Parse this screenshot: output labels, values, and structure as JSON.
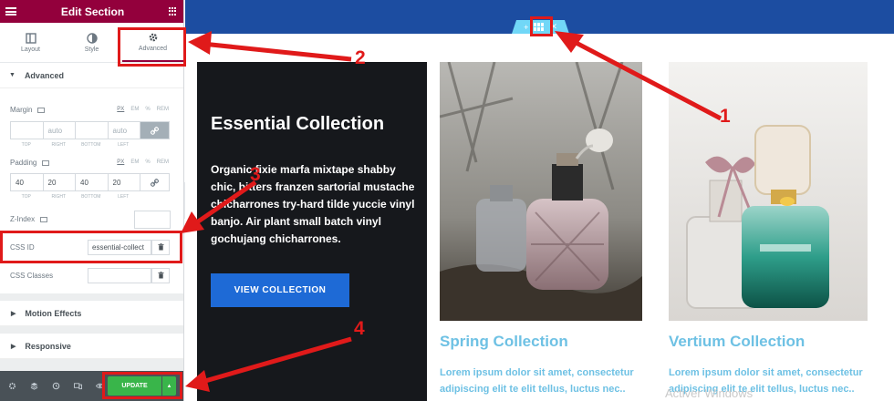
{
  "panel": {
    "title": "Edit Section",
    "tabs": [
      {
        "label": "Layout",
        "icon": "layout-icon"
      },
      {
        "label": "Style",
        "icon": "style-icon"
      },
      {
        "label": "Advanced",
        "icon": "gear-icon"
      }
    ],
    "section_advanced": "Advanced",
    "margin": {
      "label": "Margin",
      "units": [
        "PX",
        "EM",
        "%",
        "REM"
      ],
      "values": [
        "",
        "auto",
        "",
        "auto"
      ],
      "sides": [
        "TOP",
        "RIGHT",
        "BOTTOM",
        "LEFT"
      ]
    },
    "padding": {
      "label": "Padding",
      "units": [
        "PX",
        "EM",
        "%",
        "REM"
      ],
      "values": [
        "40",
        "20",
        "40",
        "20"
      ],
      "sides": [
        "TOP",
        "RIGHT",
        "BOTTOM",
        "LEFT"
      ]
    },
    "zindex_label": "Z-Index",
    "css_id": {
      "label": "CSS ID",
      "value": "essential-collect"
    },
    "css_classes": {
      "label": "CSS Classes",
      "value": ""
    },
    "motion_effects": "Motion Effects",
    "responsive": "Responsive",
    "update_label": "UPDATE"
  },
  "preview": {
    "dark_card": {
      "heading": "Essential Collection",
      "body": "Organic fixie marfa mixtape shabby chic, bitters franzen sartorial mustache chicharrones try-hard tilde yuccie vinyl banjo. Air plant small batch vinyl gochujang chicharrones.",
      "button": "VIEW COLLECTION"
    },
    "cards": [
      {
        "title": "Spring Collection",
        "text1": "Lorem ipsum dolor sit amet, consectetur",
        "text2": "adipiscing elit te elit tellus, luctus nec.."
      },
      {
        "title": "Vertium Collection",
        "text1": "Lorem ipsum dolor sit amet, consectetur",
        "text2": "adipiscing elit te elit tellus, luctus nec.."
      }
    ],
    "watermark": "Activer Windows"
  },
  "annotations": [
    "1",
    "2",
    "3",
    "4"
  ],
  "colors": {
    "brand": "#93003c",
    "topbar": "#1c4da1",
    "accent_text": "#6ec1e4",
    "update": "#39b54a",
    "highlight": "#e01a1a"
  }
}
